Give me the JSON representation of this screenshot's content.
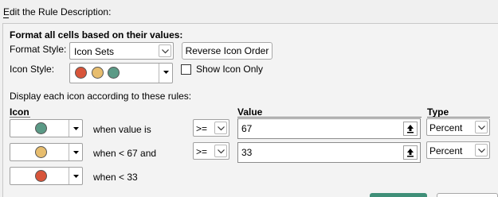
{
  "dialog": {
    "section_title": "Edit the Rule Description:"
  },
  "format_heading": "Format all cells based on their values:",
  "format_style": {
    "label": "Format Style:",
    "value": "Icon Sets"
  },
  "reverse_button": "Reverse Icon Order",
  "icon_style": {
    "label": "Icon Style:",
    "icons": [
      "red-circle-icon",
      "yellow-circle-icon",
      "green-circle-icon"
    ],
    "colors": {
      "red": "#d8553a",
      "yellow": "#e7bd6e",
      "green": "#5b9a86"
    }
  },
  "show_icon_only": {
    "label": "Show Icon Only",
    "checked": false
  },
  "rules_heading": "Display each icon according to these rules:",
  "columns": {
    "icon": "Icon",
    "value": "Value",
    "type": "Type"
  },
  "rules": [
    {
      "icon": "green-circle-icon",
      "condition": "when value is",
      "operator": ">=",
      "value": "67",
      "type": "Percent"
    },
    {
      "icon": "yellow-circle-icon",
      "condition": "when < 67 and",
      "operator": ">=",
      "value": "33",
      "type": "Percent"
    },
    {
      "icon": "red-circle-icon",
      "condition": "when < 33"
    }
  ]
}
